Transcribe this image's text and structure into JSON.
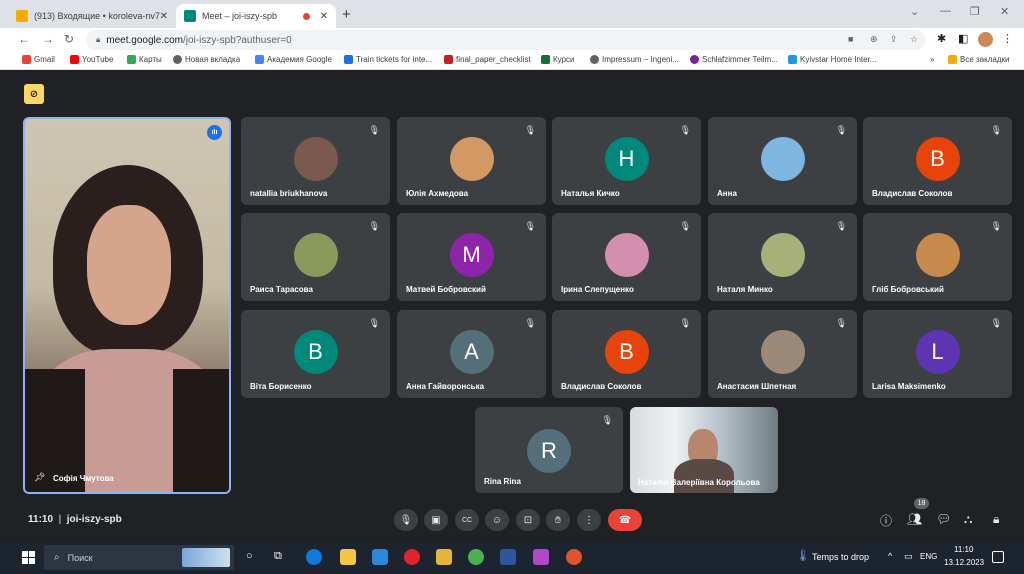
{
  "browser": {
    "tabs": [
      {
        "title": "(913) Входящие • koroleva-nv7",
        "favicon_color": "#f9ab00"
      },
      {
        "title": "Meet – joi-iszy-spb",
        "favicon_color": "#00897b"
      }
    ],
    "url_host": "meet.google.com",
    "url_path": "/joi-iszy-spb?authuser=0",
    "bookmarks": [
      {
        "label": "Gmail",
        "color": "#ea4335"
      },
      {
        "label": "YouTube",
        "color": "#ff0000"
      },
      {
        "label": "Карты",
        "color": "#34a853"
      },
      {
        "label": "Новая вкладка",
        "color": "#5f6368"
      },
      {
        "label": "Академия Google",
        "color": "#4285f4"
      },
      {
        "label": "Train tickets for inte...",
        "color": "#1a73e8"
      },
      {
        "label": "final_paper_checklist",
        "color": "#c5221f"
      },
      {
        "label": "Курси",
        "color": "#137333"
      },
      {
        "label": "Impressum – Ingeni...",
        "color": "#5f6368"
      },
      {
        "label": "Schlafzimmer Teilm...",
        "color": "#7b1fa2"
      },
      {
        "label": "Kyivstar Home Inter...",
        "color": "#1a9be8"
      }
    ],
    "bookmarks_more": "»",
    "all_bookmarks": "Все закладки"
  },
  "meet": {
    "speaker_name": "Софія Чмутова",
    "participants": [
      {
        "name": "natallia briukhanova",
        "photo": "#7a5a4e"
      },
      {
        "name": "Юлія Ахмедова",
        "photo": "#d29a62"
      },
      {
        "name": "Наталья Кичко",
        "initial": "Н",
        "color": "#00897b"
      },
      {
        "name": "Анна",
        "photo": "#7fb6e0"
      },
      {
        "name": "Владислав Соколов",
        "initial": "В",
        "color": "#e8430a"
      },
      {
        "name": "Раиса Тарасова",
        "photo": "#8a9a5a"
      },
      {
        "name": "Матвей Бобровский",
        "initial": "M",
        "color": "#8e24aa"
      },
      {
        "name": "Ірина Слепущенко",
        "photo": "#d58fae"
      },
      {
        "name": "Наталя Минко",
        "photo": "#a8b07a"
      },
      {
        "name": "Гліб Бобровський",
        "photo": "#c88a4a"
      },
      {
        "name": "Віта Борисенко",
        "initial": "B",
        "color": "#00897b"
      },
      {
        "name": "Анна Гайворонська",
        "initial": "A",
        "color": "#546e7a"
      },
      {
        "name": "Владислав Соколов",
        "initial": "B",
        "color": "#e8430a"
      },
      {
        "name": "Анастасия Шпетная",
        "photo": "#9a8a7a"
      },
      {
        "name": "Larisa Maksimenko",
        "initial": "L",
        "color": "#5e35b1"
      },
      {
        "name": "Rina Rina",
        "initial": "R",
        "color": "#546e7a"
      }
    ],
    "self_name": "Наталія Валеріївна Корольова",
    "time": "11:10",
    "meeting_code": "joi-iszy-spb",
    "participants_count": "18",
    "end_call_color": "#ea4335"
  },
  "taskbar": {
    "search_placeholder": "Поиск",
    "weather": "Temps to drop",
    "lang": "ENG",
    "time": "11:10",
    "date": "13.12.2023"
  }
}
